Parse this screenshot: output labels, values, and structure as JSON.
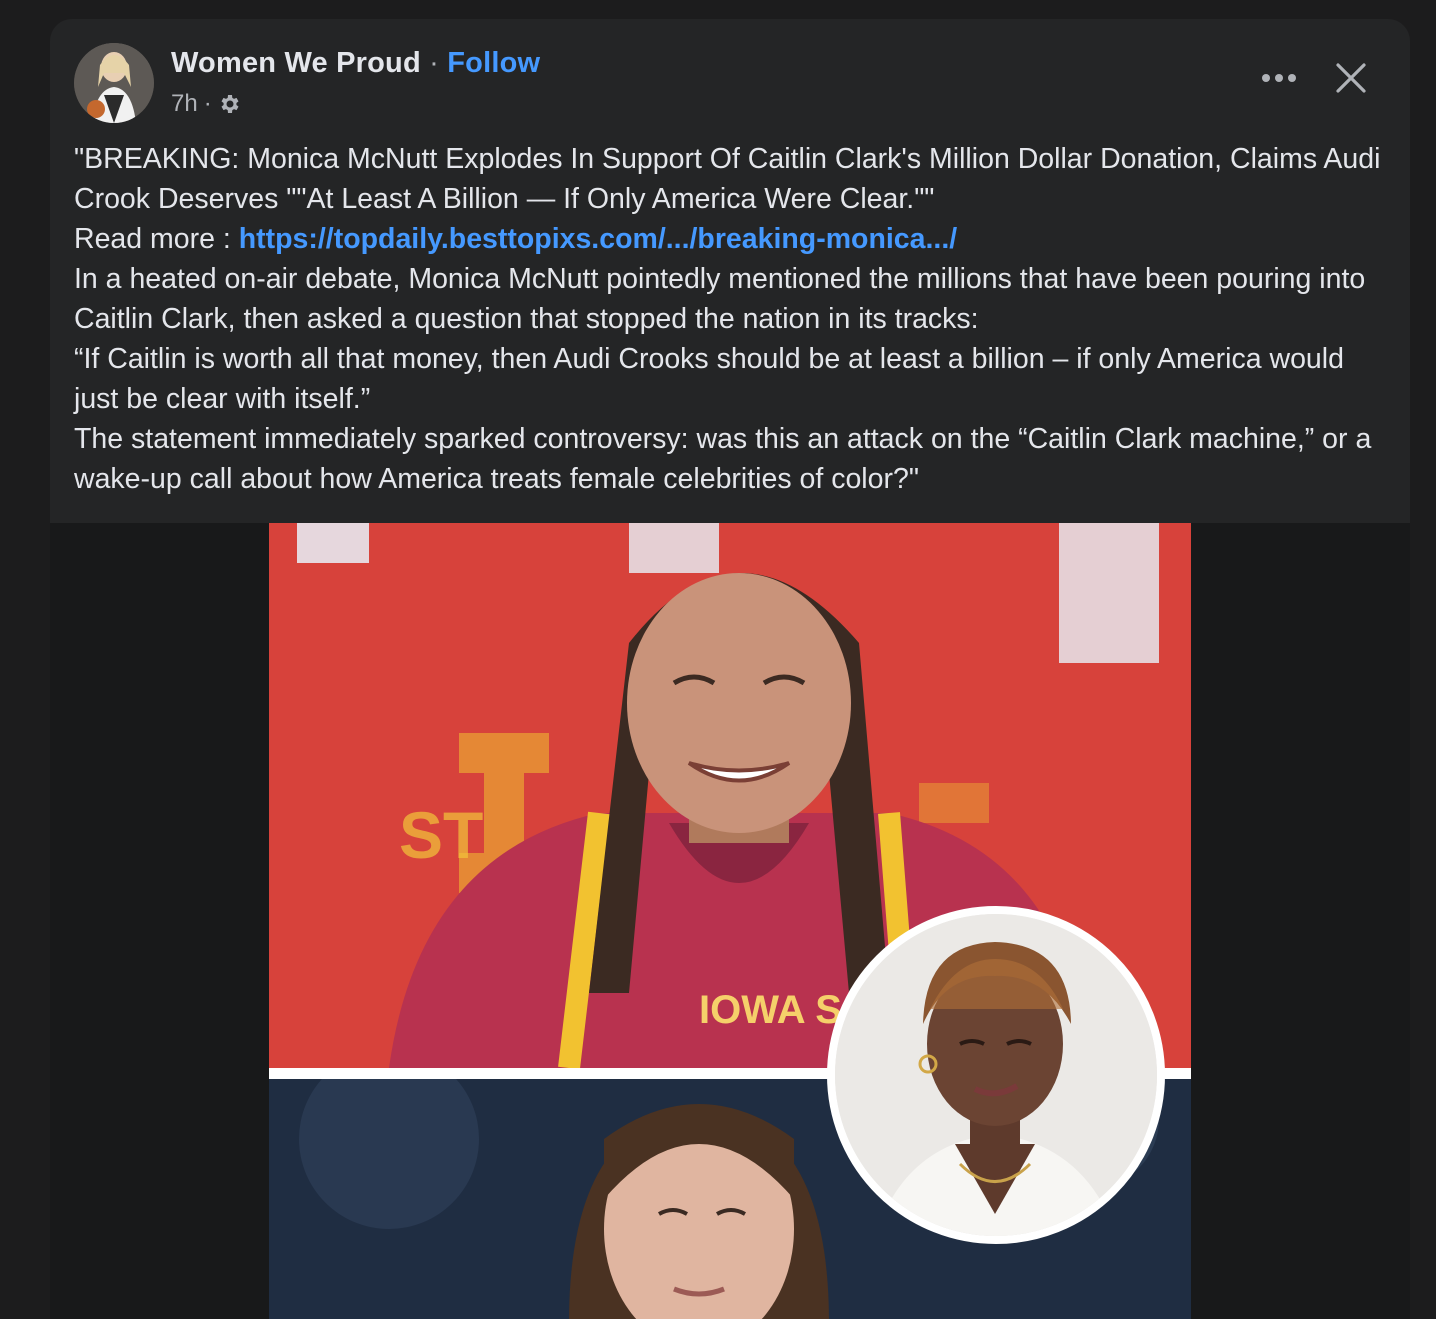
{
  "post": {
    "page_name": "Women We Proud",
    "separator": "·",
    "follow_label": "Follow",
    "time": "7h",
    "time_separator": "·",
    "audience_icon": "gear-icon",
    "more_icon": "more-horizontal-icon",
    "close_icon": "close-icon",
    "body": {
      "line1": "\"BREAKING: Monica McNutt Explodes In Support Of Caitlin Clark's Million Dollar Donation, Claims Audi Crook Deserves \"\"At Least A Billion — If Only America Were Clear.\"\"",
      "read_more_label": "Read more :",
      "read_more_link": "https://topdaily.besttopixs.com/.../breaking-monica.../",
      "paragraph2": "In a heated on-air debate, Monica McNutt pointedly mentioned the millions that have been pouring into Caitlin Clark, then asked a question that stopped the nation in its tracks:",
      "paragraph3": "“If Caitlin is worth all that money, then Audi Crooks should be at least a billion – if only America would just be clear with itself.”",
      "paragraph4": "The statement immediately sparked controversy: was this an attack on the “Caitlin Clark machine,” or a wake-up call about how America treats female celebrities of color?\""
    },
    "image_jersey_text": "ST",
    "image_jersey_name": "IOWA S"
  },
  "colors": {
    "background": "#1c1c1d",
    "card": "#242526",
    "text": "#e4e6eb",
    "secondary_text": "#b0b3b8",
    "link": "#4599ff"
  }
}
